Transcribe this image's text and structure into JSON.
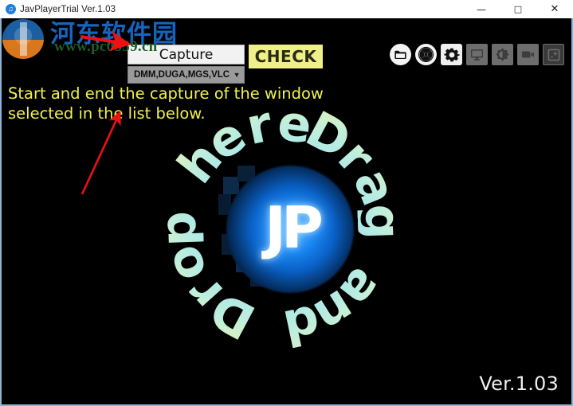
{
  "window": {
    "title": "JavPlayerTrial Ver.1.03",
    "icon": "jp-app-icon",
    "buttons": {
      "minimize": "—",
      "maximize": "☐",
      "close": "✕"
    }
  },
  "controls": {
    "capture_label": "Capture",
    "check_label": "CHECK",
    "source_value": "DMM,DUGA,MGS,VLC",
    "source_caret": "▼"
  },
  "toolbar": {
    "icons": [
      {
        "name": "folder-icon",
        "style": "circle-light"
      },
      {
        "name": "disc-icon",
        "style": "circle-light"
      },
      {
        "name": "gear-icon",
        "style": "square-active"
      },
      {
        "name": "monitor-icon",
        "style": "square-inactive"
      },
      {
        "name": "contrast-icon",
        "style": "square-inactive"
      },
      {
        "name": "camcorder-icon",
        "style": "square-inactive"
      },
      {
        "name": "effects-icon",
        "style": "square-outline"
      }
    ]
  },
  "main": {
    "hint_line1": "Start and end the capture of the window",
    "hint_line2": "selected in the list below.",
    "ring_text": "Drag and Drop here",
    "ring_letters": [
      "D",
      "r",
      "a",
      "g",
      " ",
      "a",
      "n",
      "d",
      " ",
      "D",
      "r",
      "o",
      "p",
      " ",
      "h",
      "e",
      "r",
      "e"
    ],
    "logo_mark": "JP",
    "version": "Ver.1.03"
  },
  "watermark": {
    "site_name": "河东软件园",
    "url": "www.pc0359.cn"
  },
  "colors": {
    "background": "#000000",
    "window_border": "#8ab4d8",
    "hint_text": "#f2f24a",
    "check_button": "#f0f08a",
    "capture_button": "#f2f2f2",
    "select_background": "#9a9a9a",
    "logo_blue": "#1683f0",
    "ring_gradient_start": "#dff3b9",
    "ring_gradient_end": "#a7e6ea",
    "annotation_arrow": "#ee1111",
    "watermark_blue": "#1565c0",
    "watermark_green": "#1d5c28"
  }
}
